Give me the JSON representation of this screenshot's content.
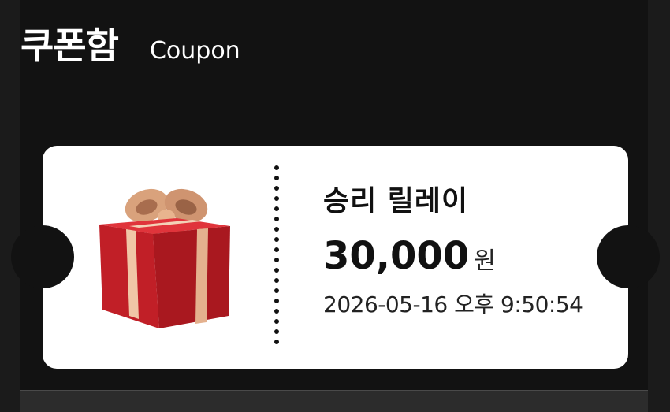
{
  "header": {
    "title_ko": "쿠폰함",
    "title_en": "Coupon"
  },
  "coupon": {
    "name": "승리 릴레이",
    "amount": "30,000",
    "unit": "원",
    "datetime": "2026-05-16 오후 9:50:54",
    "image_icon": "gift-box-icon"
  },
  "colors": {
    "background": "#121212",
    "card": "#ffffff",
    "gift_red": "#c4232b",
    "ribbon_gold": "#e0a878"
  }
}
